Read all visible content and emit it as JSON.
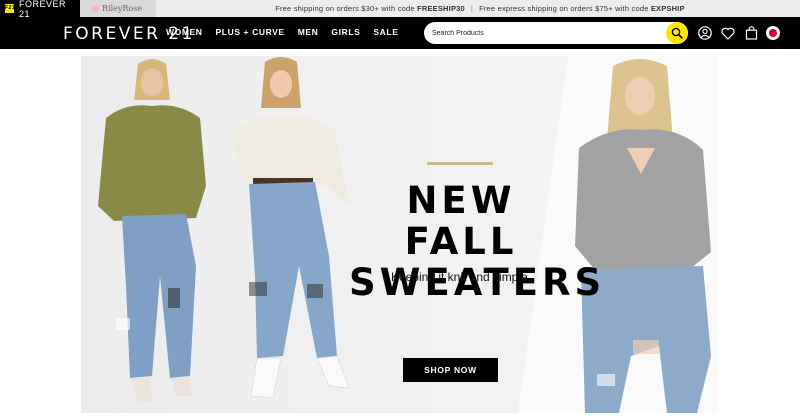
{
  "brand_tabs": {
    "forever21": {
      "badge": "F21",
      "label": "FOREVER 21"
    },
    "rileyrose": {
      "label": "RileyRose"
    }
  },
  "promo": {
    "part1_prefix": "Free shipping on orders $30+ with code ",
    "part1_code": "FREESHIP30",
    "separator": "|",
    "part2_prefix": "Free express shipping on orders $75+ with code ",
    "part2_code": "EXPSHIP"
  },
  "header": {
    "logo": "FOREVER 21",
    "menu": [
      "WOMEN",
      "PLUS + CURVE",
      "MEN",
      "GIRLS",
      "SALE"
    ],
    "search": {
      "placeholder": "Search Products",
      "icon": "search-icon"
    },
    "icons": [
      "account-icon",
      "wishlist-heart-icon",
      "shopping-bag-icon",
      "country-flag-icon"
    ]
  },
  "hero": {
    "headline_line1": "NEW FALL",
    "headline_line2": "SWEATERS",
    "tagline": "Keeping it knit and simple.",
    "cta": "SHOP NOW",
    "accent_color": "#c8b88a",
    "models": [
      {
        "sweater_color": "#8a8a47",
        "jeans_color": "#7fa0c4"
      },
      {
        "sweater_color": "#efebe1",
        "jeans_color": "#86a7c9"
      },
      {
        "sweater_color": "#a2a2a4",
        "jeans_color": "#8eaacb"
      }
    ]
  },
  "colors": {
    "nav_bg": "#000000",
    "search_button": "#ffe600",
    "flag_red": "#d5002c"
  }
}
